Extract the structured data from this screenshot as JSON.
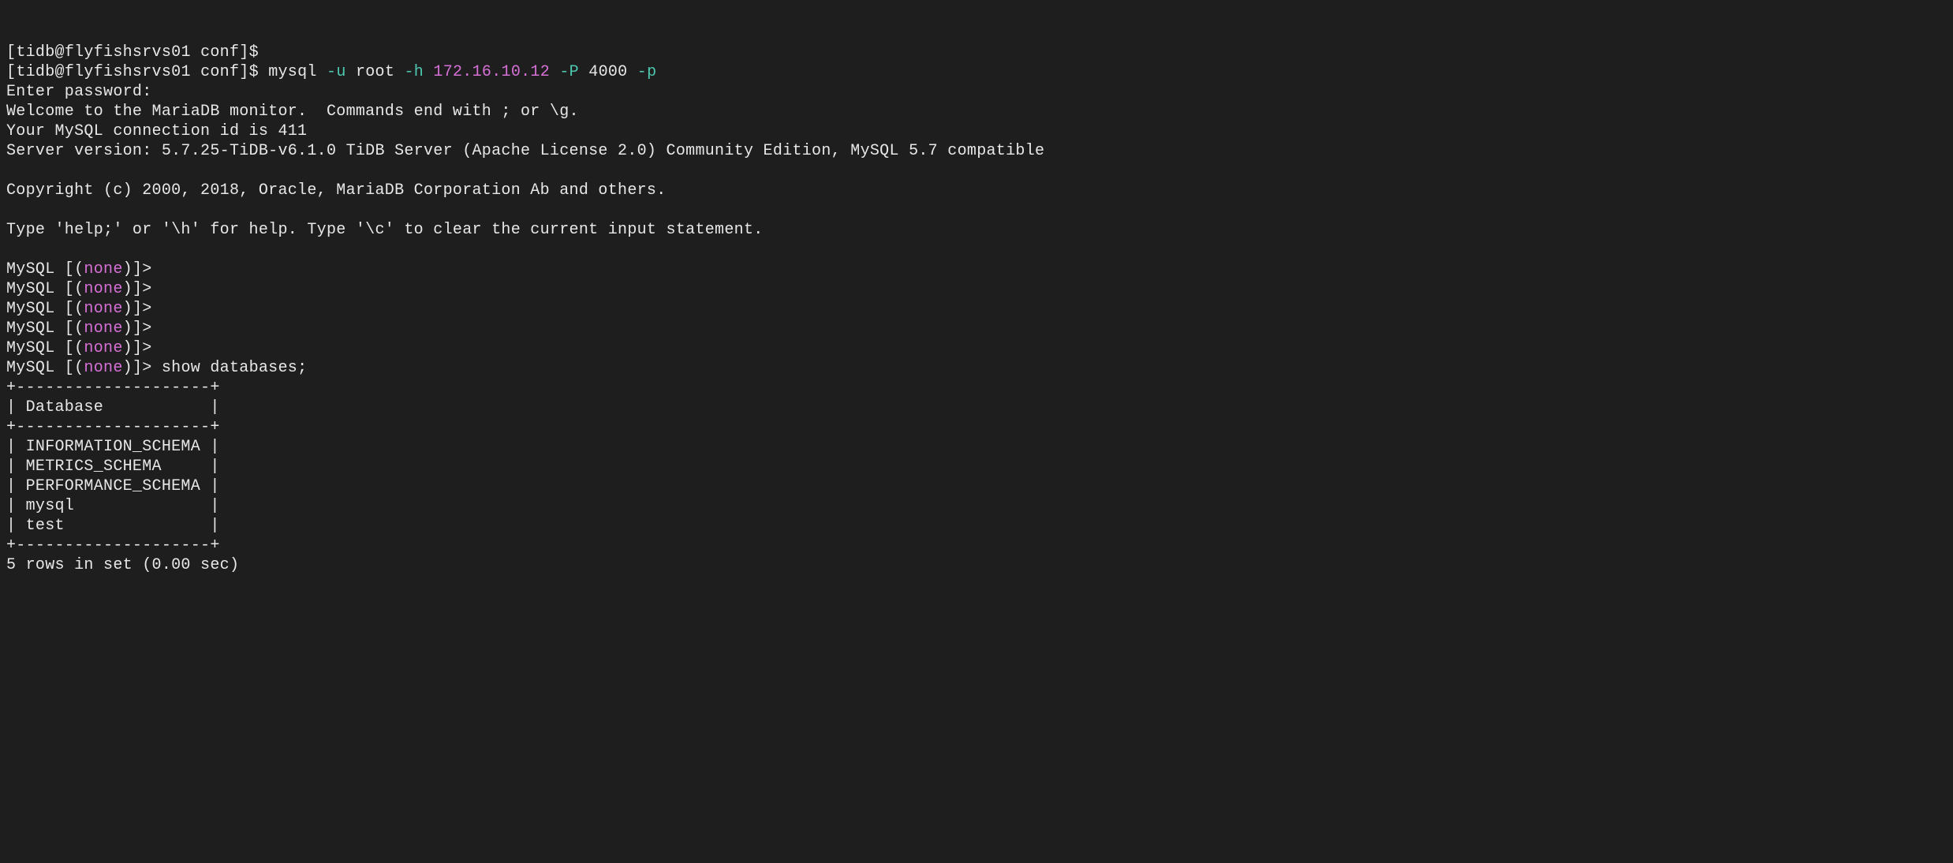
{
  "prompt_user": "tidb@flyfishsrvs01",
  "prompt_dir": "conf",
  "cmd": {
    "bin": "mysql",
    "f_u": "-u",
    "v_u": "root",
    "f_h": "-h",
    "v_h": "172.16.10.12",
    "f_P": "-P",
    "v_P": "4000",
    "f_p": "-p"
  },
  "lines": {
    "enter_pw": "Enter password:",
    "welcome": "Welcome to the MariaDB monitor.  Commands end with ; or \\g.",
    "conn_id": "Your MySQL connection id is 411",
    "server": "Server version: 5.7.25-TiDB-v6.1.0 TiDB Server (Apache License 2.0) Community Edition, MySQL 5.7 compatible",
    "copyright": "Copyright (c) 2000, 2018, Oracle, MariaDB Corporation Ab and others.",
    "help": "Type 'help;' or '\\h' for help. Type '\\c' to clear the current input statement."
  },
  "mysql_prompt": {
    "pre": "MySQL [(",
    "db": "none",
    "post": ")]>"
  },
  "sql_cmd": "show databases;",
  "table": {
    "border": "+--------------------+",
    "header": "| Database           |",
    "rows": [
      "| INFORMATION_SCHEMA |",
      "| METRICS_SCHEMA     |",
      "| PERFORMANCE_SCHEMA |",
      "| mysql              |",
      "| test               |"
    ],
    "footer": "5 rows in set (0.00 sec)"
  }
}
